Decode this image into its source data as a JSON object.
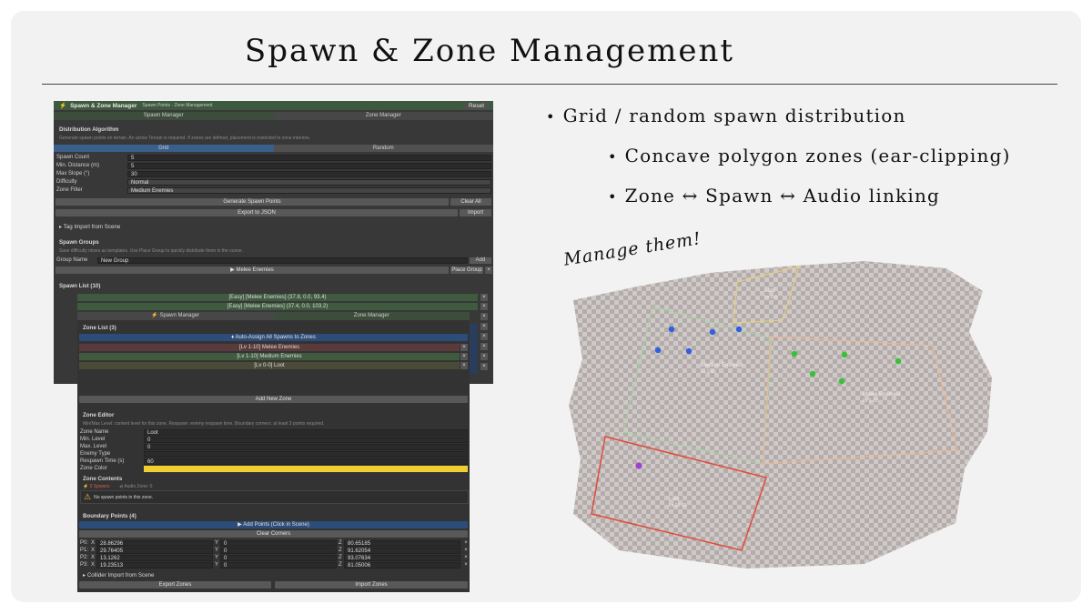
{
  "slide": {
    "title": "Spawn & Zone Management",
    "bullets": [
      "Grid / random spawn distribution",
      "Concave polygon zones (ear-clipping)",
      "Zone ↔ Spawn ↔ Audio linking"
    ],
    "caption": "Manage them!"
  },
  "spawn_editor": {
    "title": "Spawn & Zone Manager",
    "subtitle": "Spawn Points · Zone Management",
    "reset": "Reset",
    "tabs": [
      "Spawn Manager",
      "Zone Manager"
    ],
    "algo_title": "Distribution Algorithm",
    "algo_note": "Generate spawn points on terrain. An active Terrain is required. If zones are defined, placement is restricted to zone interiors.",
    "algo_options": [
      "Grid",
      "Random"
    ],
    "fields": [
      {
        "label": "Spawn Count",
        "value": "5"
      },
      {
        "label": "Min. Distance (m)",
        "value": "5"
      },
      {
        "label": "Max Slope (°)",
        "value": "30"
      },
      {
        "label": "Difficulty",
        "value": "Normal"
      },
      {
        "label": "Zone Filter",
        "value": "Medium Enemies"
      }
    ],
    "generate": "Generate Spawn Points",
    "clear_all": "Clear All",
    "export_json": "Export to JSON",
    "import": "Import",
    "tag_import": "Tag Import from Scene",
    "groups_title": "Spawn Groups",
    "groups_note": "Save difficulty mixes as templates. Use Place Group to quickly distribute them in the scene.",
    "group_name_label": "Group Name",
    "group_name_value": "New Group",
    "add": "Add",
    "group_item": "▶ Melee Enemies",
    "place_group": "Place Group",
    "list_title": "Spawn List (10)",
    "list_items": [
      "[Easy] [Melee Enemies]  (37.8, 0.0, 93.4)",
      "[Easy] [Melee Enemies]  (37.4, 0.0, 103.2)"
    ]
  },
  "zone_editor": {
    "tabs": [
      "Spawn Manager",
      "Zone Manager"
    ],
    "zone_list_title": "Zone List (3)",
    "auto_assign": "♦ Auto-Assign All Spawns to Zones",
    "zones": [
      "[Lv 1-10] Melee Enemies",
      "[Lv 1-10] Medium Enemies",
      "[Lv 0-0] Loot"
    ],
    "add_zone": "Add New Zone",
    "editor_title": "Zone Editor",
    "editor_note": "Min/Max Level: content level for this zone. Respawn: enemy respawn time. Boundary corners: at least 3 points required.",
    "fields": [
      {
        "label": "Zone Name",
        "value": "Loot"
      },
      {
        "label": "Min. Level",
        "value": "0"
      },
      {
        "label": "Max. Level",
        "value": "0"
      },
      {
        "label": "Enemy Type",
        "value": ""
      },
      {
        "label": "Respawn Time (s)",
        "value": "60"
      },
      {
        "label": "Zone Color",
        "value": ""
      }
    ],
    "zone_color": "#f0d030",
    "contents_title": "Zone Contents",
    "contents_spawns": "0 Spawns",
    "contents_audio": "Audio Zone: 0",
    "warning": "No spawn points in this zone.",
    "boundary_title": "Boundary Points (4)",
    "add_points": "▶ Add Points (Click in Scene)",
    "clear_corners": "Clear Corners",
    "points": [
      {
        "id": "P0:",
        "x": "28.86296",
        "y": "0",
        "z": "80.65185"
      },
      {
        "id": "P1:",
        "x": "29.76405",
        "y": "0",
        "z": "91.62054"
      },
      {
        "id": "P2:",
        "x": "13.1262",
        "y": "0",
        "z": "93.07634"
      },
      {
        "id": "P3:",
        "x": "19.23513",
        "y": "0",
        "z": "81.05006"
      }
    ],
    "collider_import": "Collider Import from Scene",
    "export_zones": "Export Zones",
    "import_zones": "Import Zones"
  },
  "map": {
    "zones": [
      {
        "label": "Loot",
        "sub": "Lv 0-0",
        "color": "#e8d27a"
      },
      {
        "label": "Medium Enemies",
        "sub": "Lv 1-10",
        "color": "#a6d6a0"
      },
      {
        "label": "Melee Enemies",
        "sub": "Lv 1-10",
        "color": "#f0b890"
      },
      {
        "label": "Loot",
        "sub": "Lv 10-10",
        "color": "#e24a3a"
      }
    ]
  }
}
